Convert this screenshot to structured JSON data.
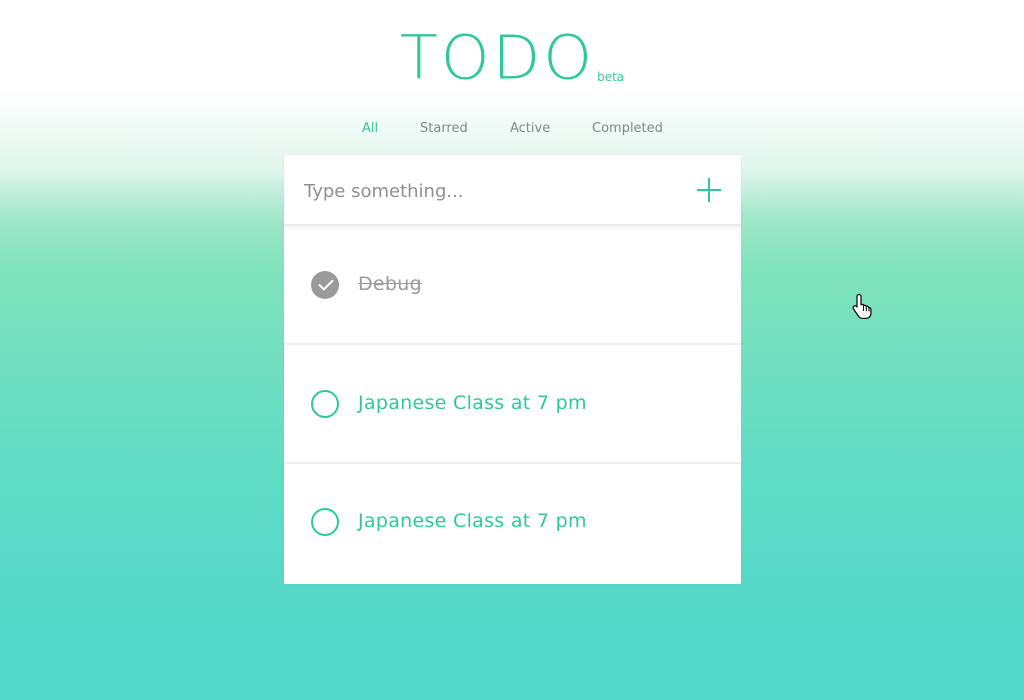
{
  "header": {
    "title": "TODO",
    "badge": "beta"
  },
  "filters": [
    {
      "label": "All",
      "active": true
    },
    {
      "label": "Starred",
      "active": false
    },
    {
      "label": "Active",
      "active": false
    },
    {
      "label": "Completed",
      "active": false
    }
  ],
  "input": {
    "value": "",
    "placeholder": "Type something..."
  },
  "items": [
    {
      "text": "Debug",
      "completed": true
    },
    {
      "text": "Japanese Class at 7 pm",
      "completed": false
    },
    {
      "text": "Japanese Class at 7 pm",
      "completed": false
    }
  ],
  "colors": {
    "accent": "#2ec99b",
    "muted": "#9b9b9b",
    "filter_text": "#7b8b88",
    "gradient_top": "#ffffff",
    "gradient_bottom": "#52d8ca"
  },
  "icons": {
    "add": "plus-icon",
    "completed_check": "check-circle-icon",
    "open_check": "circle-icon",
    "pointer": "hand-pointer-icon"
  }
}
